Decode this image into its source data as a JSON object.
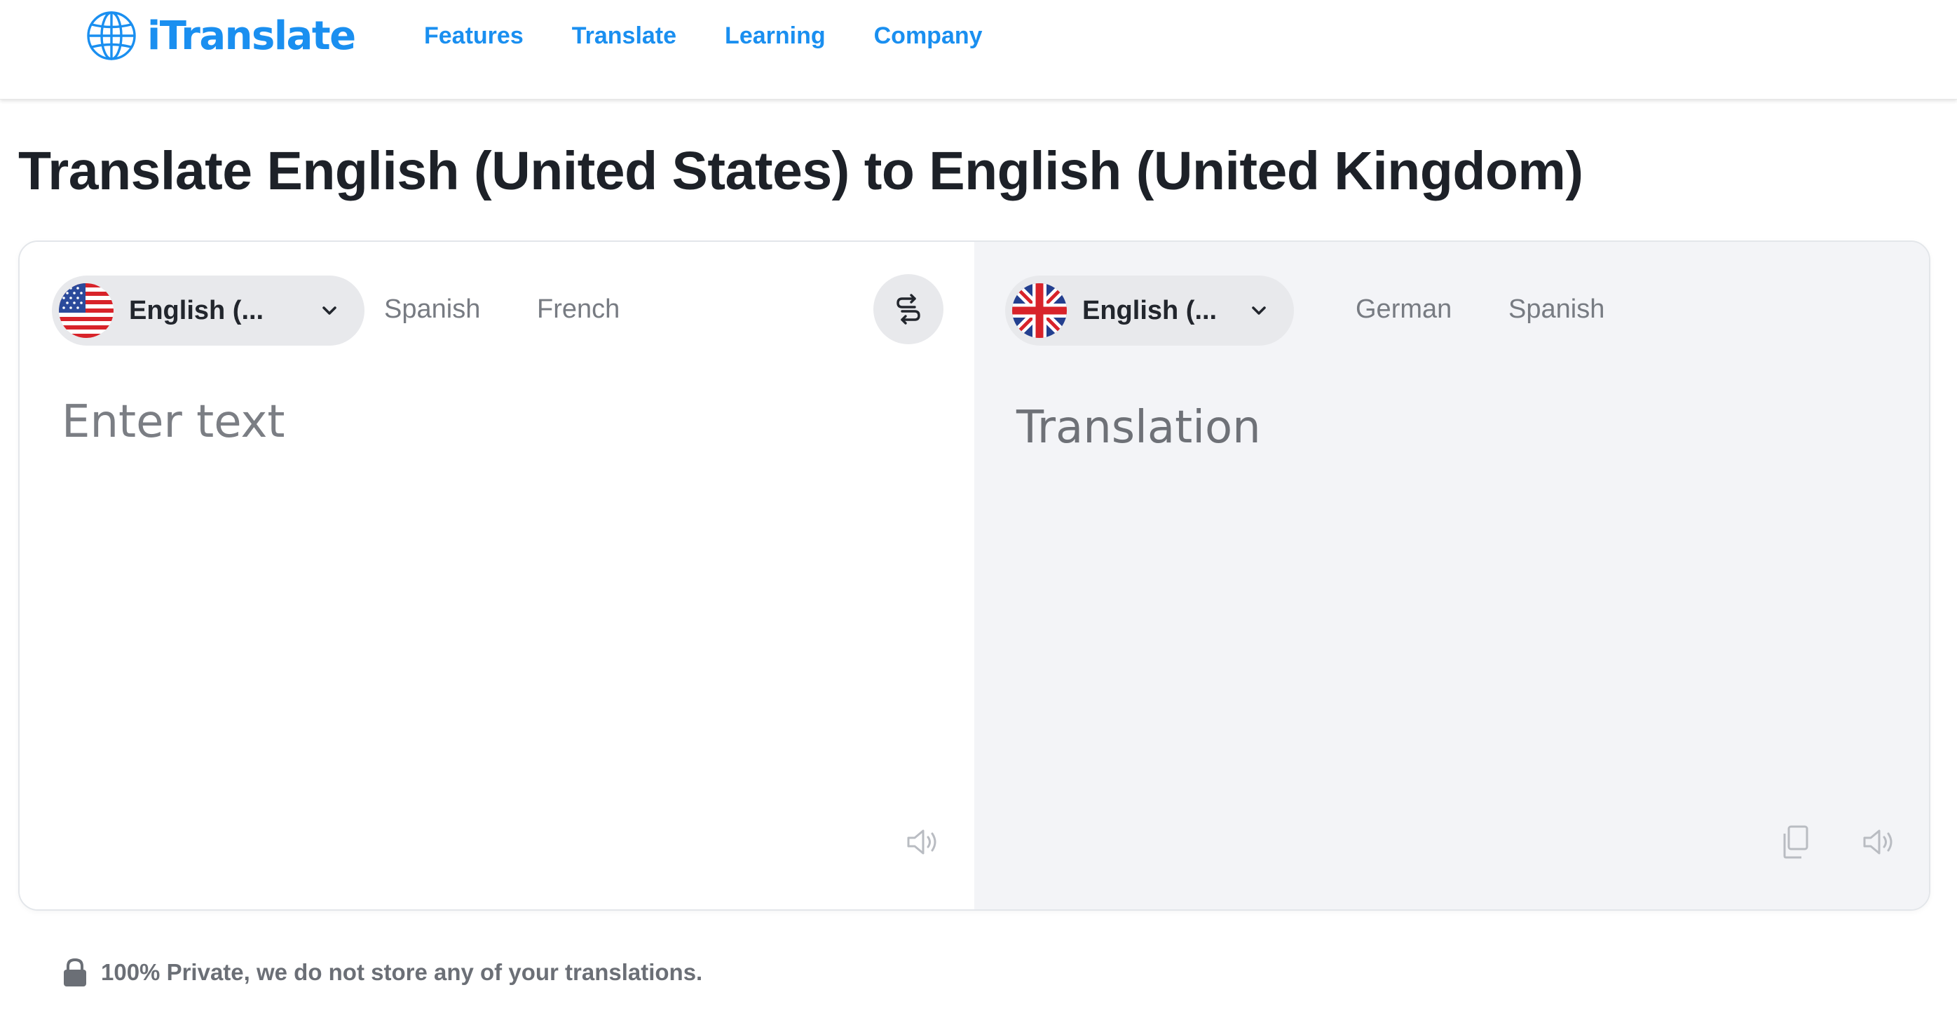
{
  "brand": {
    "name": "iTranslate",
    "color": "#1a8ff0",
    "icon": "globe-icon"
  },
  "nav": {
    "items": [
      {
        "label": "Features"
      },
      {
        "label": "Translate"
      },
      {
        "label": "Learning"
      },
      {
        "label": "Company"
      }
    ]
  },
  "title": "Translate English (United States) to English (United Kingdom)",
  "source": {
    "selected_language": "English (...",
    "flag_icon": "us-flag-icon",
    "quick_languages": [
      "Spanish",
      "French"
    ],
    "placeholder": "Enter text",
    "value": "",
    "speaker_icon": "speaker-icon"
  },
  "swap": {
    "icon": "swap-arrows-icon"
  },
  "target": {
    "selected_language": "English (...",
    "flag_icon": "uk-flag-icon",
    "quick_languages": [
      "German",
      "Spanish"
    ],
    "placeholder": "Translation",
    "copy_icon": "copy-icon",
    "speaker_icon": "speaker-icon"
  },
  "footer": {
    "icon": "lock-icon",
    "privacy_text": "100% Private, we do not store any of your translations."
  }
}
